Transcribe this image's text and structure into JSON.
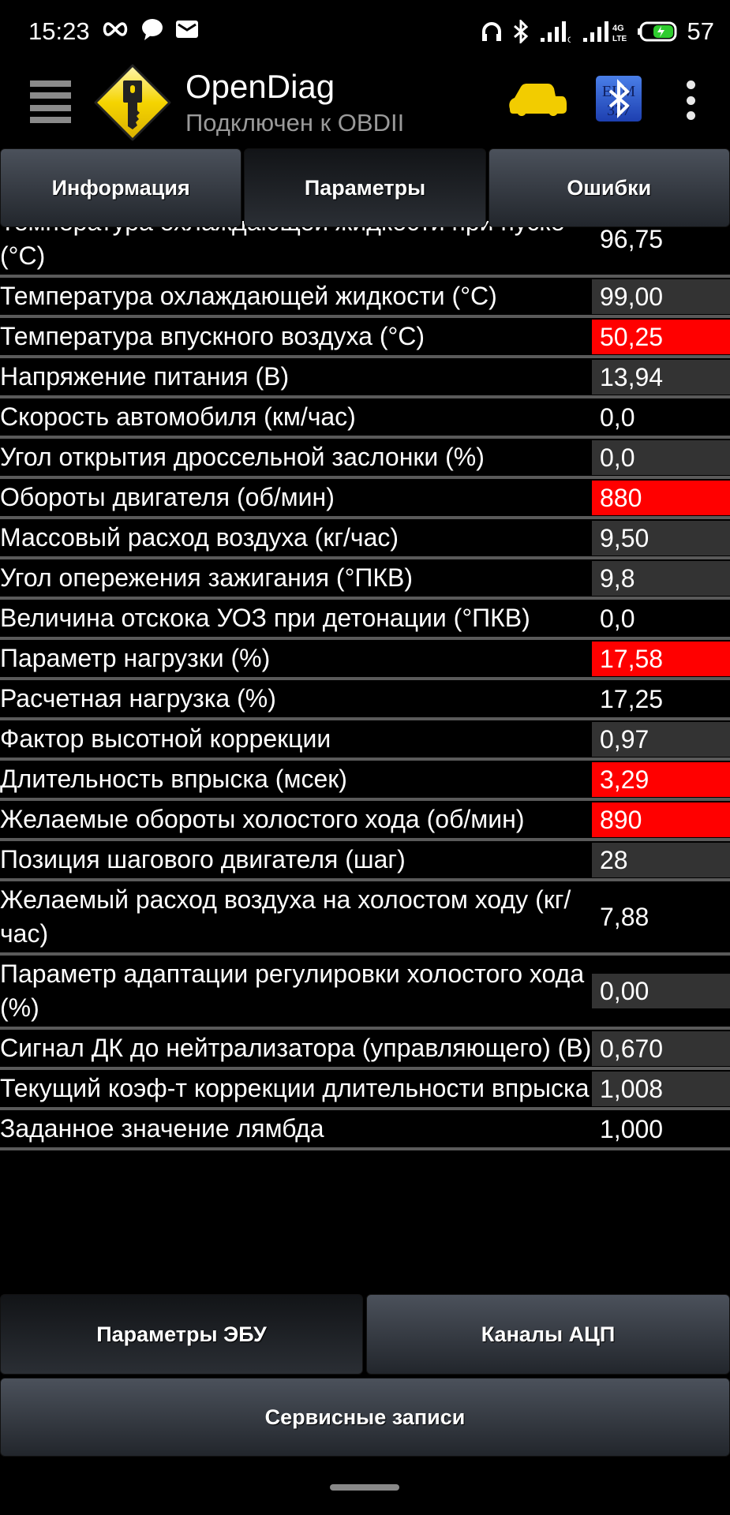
{
  "status_bar": {
    "time": "15:23",
    "battery_level": "57",
    "network_1": "G",
    "network_2": "4G LTE"
  },
  "app_bar": {
    "title": "OpenDiag",
    "subtitle": "Подключен к OBDII",
    "bt_badge_text": "ELM 327"
  },
  "tabs": [
    {
      "label": "Информация",
      "active": false
    },
    {
      "label": "Параметры",
      "active": true
    },
    {
      "label": "Ошибки",
      "active": false
    }
  ],
  "parameters": [
    {
      "label": "Температура охлаждающей жидкости при пуске (°C)",
      "value": "96,75",
      "status": "normal"
    },
    {
      "label": "Температура охлаждающей жидкости (°C)",
      "value": "99,00",
      "status": "shaded"
    },
    {
      "label": "Температура впускного воздуха (°C)",
      "value": "50,25",
      "status": "alarm"
    },
    {
      "label": "Напряжение питания (В)",
      "value": "13,94",
      "status": "shaded"
    },
    {
      "label": "Скорость автомобиля (км/час)",
      "value": "0,0",
      "status": "normal"
    },
    {
      "label": "Угол открытия дроссельной заслонки (%)",
      "value": "0,0",
      "status": "shaded"
    },
    {
      "label": "Обороты двигателя (об/мин)",
      "value": "880",
      "status": "alarm"
    },
    {
      "label": "Массовый расход воздуха (кг/час)",
      "value": "9,50",
      "status": "shaded"
    },
    {
      "label": "Угол опережения зажигания (°ПКВ)",
      "value": "9,8",
      "status": "shaded"
    },
    {
      "label": "Величина отскока УОЗ при детонации (°ПКВ)",
      "value": "0,0",
      "status": "normal"
    },
    {
      "label": "Параметр нагрузки (%)",
      "value": "17,58",
      "status": "alarm"
    },
    {
      "label": "Расчетная нагрузка (%)",
      "value": "17,25",
      "status": "normal"
    },
    {
      "label": "Фактор высотной коррекции",
      "value": "0,97",
      "status": "shaded"
    },
    {
      "label": "Длительность впрыска (мсек)",
      "value": "3,29",
      "status": "alarm"
    },
    {
      "label": "Желаемые обороты холостого хода (об/мин)",
      "value": "890",
      "status": "alarm"
    },
    {
      "label": "Позиция шагового двигателя (шаг)",
      "value": "28",
      "status": "shaded"
    },
    {
      "label": "Желаемый расход воздуха на холостом ходу (кг/час)",
      "value": "7,88",
      "status": "normal"
    },
    {
      "label": "Параметр адаптации регулировки холостого хода (%)",
      "value": "0,00",
      "status": "shaded"
    },
    {
      "label": "Сигнал ДК до нейтрализатора (управляющего) (В)",
      "value": "0,670",
      "status": "shaded"
    },
    {
      "label": "Текущий коэф-т коррекции длительности впрыска",
      "value": "1,008",
      "status": "shaded"
    },
    {
      "label": "Заданное значение лямбда",
      "value": "1,000",
      "status": "normal"
    }
  ],
  "bottom_buttons": {
    "ecu_params": "Параметры ЭБУ",
    "adc_channels": "Каналы АЦП",
    "service_records": "Сервисные записи"
  },
  "colors": {
    "alarm": "#ff0000",
    "shaded": "#333333",
    "accent_yellow": "#f2cc00"
  }
}
